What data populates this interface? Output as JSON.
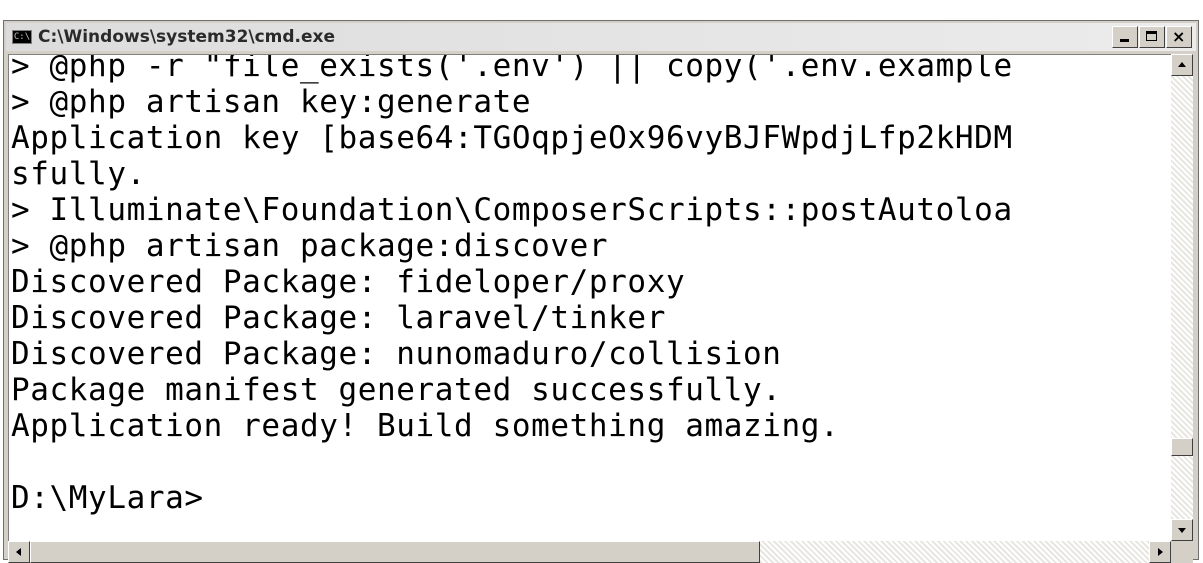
{
  "window": {
    "title": "C:\\Windows\\system32\\cmd.exe",
    "icon": "cmd-icon",
    "icon_glyph": "C:\\",
    "buttons": {
      "minimize": "minimize-icon",
      "maximize": "maximize-icon",
      "close": "close-icon",
      "close_glyph": "×"
    }
  },
  "console": {
    "lines": [
      "> @php -r \"file_exists('.env') || copy('.env.example",
      "> @php artisan key:generate",
      "Application key [base64:TGOqpjeOx96vyBJFWpdjLfp2kHDM",
      "sfully.",
      "> Illuminate\\Foundation\\ComposerScripts::postAutoloa",
      "> @php artisan package:discover",
      "Discovered Package: fideloper/proxy",
      "Discovered Package: laravel/tinker",
      "Discovered Package: nunomaduro/collision",
      "Package manifest generated successfully.",
      "Application ready! Build something amazing.",
      "",
      "D:\\MyLara>"
    ],
    "foreground": "#000000",
    "background": "#ffffff"
  },
  "scrollbars": {
    "vertical": {
      "up": "arrow-up-icon",
      "down": "arrow-down-icon"
    },
    "horizontal": {
      "left": "arrow-left-icon",
      "right": "arrow-right-icon"
    }
  }
}
